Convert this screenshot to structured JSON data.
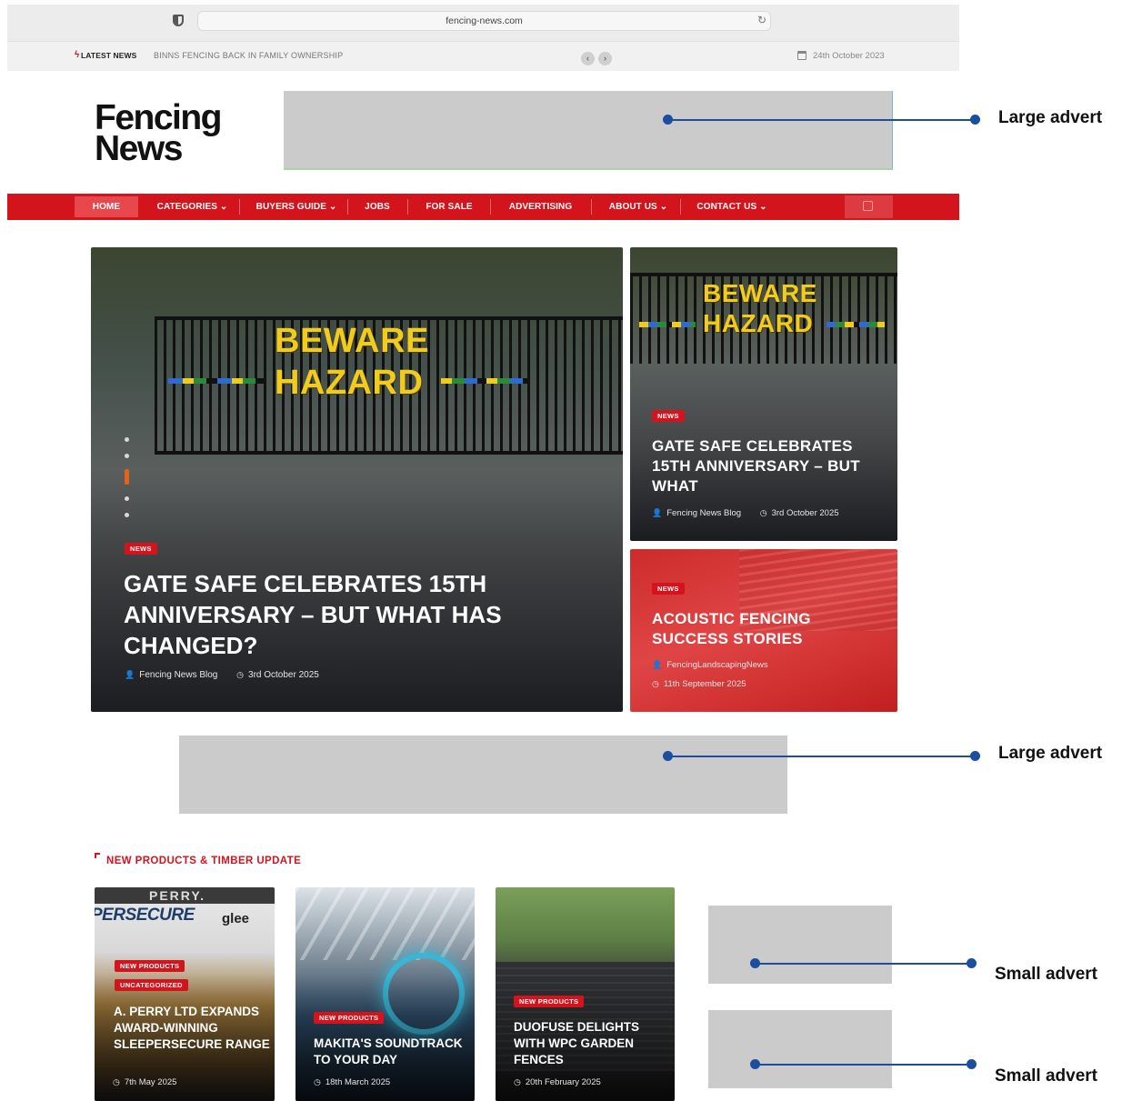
{
  "browser": {
    "url": "fencing-news.com"
  },
  "ticker": {
    "label": "LATEST NEWS",
    "headline": "BINNS FENCING BACK IN FAMILY OWNERSHIP",
    "prev": "‹",
    "next": "›",
    "date": "24th October 2023"
  },
  "logo": {
    "line1": "Fencing",
    "line2": "News"
  },
  "nav": {
    "items": [
      "HOME",
      "CATEGORIES ⌄",
      "BUYERS GUIDE ⌄",
      "JOBS",
      "FOR SALE",
      "ADVERTISING",
      "ABOUT US ⌄",
      "CONTACT US ⌄"
    ],
    "accent": "#d4141c"
  },
  "hero": {
    "main": {
      "sign": [
        "BEWARE",
        "HAZARD"
      ],
      "badge": "NEWS",
      "headline": "GATE SAFE CELEBRATES 15TH ANNIVERSARY – BUT WHAT HAS CHANGED?",
      "author": "Fencing News Blog",
      "date": "3rd October 2025"
    },
    "side1": {
      "sign": [
        "BEWARE",
        "HAZARD"
      ],
      "badge": "NEWS",
      "headline": "GATE SAFE CELEBRATES 15TH ANNIVERSARY – BUT WHAT",
      "author": "Fencing News Blog",
      "date": "3rd October 2025"
    },
    "side2": {
      "badge": "NEWS",
      "headline": "ACOUSTIC FENCING SUCCESS STORIES",
      "author": "FencingLandscapingNews",
      "date": "11th September 2025"
    }
  },
  "section": {
    "title": "NEW PRODUCTS & TIMBER UPDATE"
  },
  "cards": [
    {
      "brand": "PERRY.",
      "product": "PERSECURE",
      "logo": "glee",
      "badge_top": "NEW PRODUCTS",
      "badge": "UNCATEGORIZED",
      "headline": "A. PERRY LTD EXPANDS AWARD-WINNING SLEEPERSECURE RANGE",
      "date": "7th May 2025"
    },
    {
      "badge": "NEW PRODUCTS",
      "headline": "MAKITA'S SOUNDTRACK TO YOUR DAY",
      "date": "18th March 2025"
    },
    {
      "badge": "NEW PRODUCTS",
      "headline": "DUOFUSE DELIGHTS WITH WPC GARDEN FENCES",
      "date": "20th February 2025"
    }
  ],
  "annotations": {
    "large_advert": "Large advert",
    "small_advert": "Small advert",
    "line_color": "#1c4ea0"
  }
}
